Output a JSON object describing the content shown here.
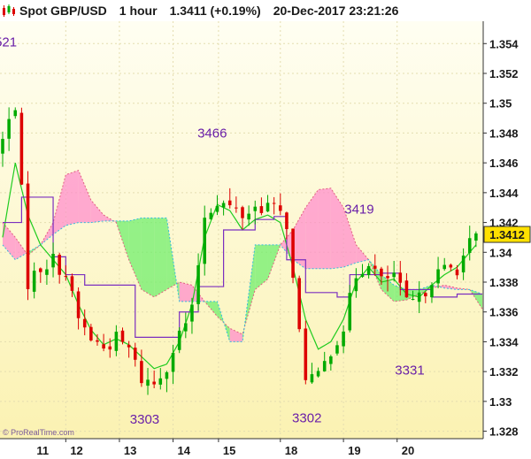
{
  "header": {
    "icon": "candlestick-icon",
    "instrument": "Spot GBP/USD",
    "timeframe": "1 hour",
    "price_change": "1.3411 (+0.19%)",
    "datetime": "20-Dec-2017 23:21:26"
  },
  "watermark": "© ProRealTime.com",
  "colors": {
    "up_candle": "#00aa00",
    "down_candle": "#dd0000",
    "tenkan": "#1fcc1f",
    "kijun": "#7b2fbf",
    "cloud_bull": "#66ee66",
    "cloud_bear": "#ff88cc",
    "label": "#6a1fa8",
    "price_box": "#ffe000"
  },
  "chart_data": {
    "type": "candlestick",
    "indicator": "ichimoku",
    "ylim": [
      1.3275,
      1.3555
    ],
    "y_ticks": [
      "1.328",
      "1.33",
      "1.332",
      "1.334",
      "1.336",
      "1.338",
      "1.34",
      "1.342",
      "1.344",
      "1.346",
      "1.348",
      "1.35",
      "1.352",
      "1.354"
    ],
    "x_ticks": [
      "11",
      "12",
      "13",
      "14",
      "15",
      "18",
      "19",
      "20"
    ],
    "last_price": "1.3412",
    "annotations": [
      {
        "text": "521",
        "x": 0.5,
        "y": 1.3538
      },
      {
        "text": "3466",
        "x": 33.2,
        "y": 1.3477
      },
      {
        "text": "3419",
        "x": 56.5,
        "y": 1.3426
      },
      {
        "text": "3331",
        "x": 64.5,
        "y": 1.3318
      },
      {
        "text": "3303",
        "x": 22.5,
        "y": 1.3285
      },
      {
        "text": "3302",
        "x": 48.2,
        "y": 1.3286
      }
    ],
    "close_anchors": [
      [
        0,
        1.3475
      ],
      [
        2,
        1.35
      ],
      [
        4,
        1.338
      ],
      [
        6,
        1.339
      ],
      [
        8,
        1.3395
      ],
      [
        10,
        1.3385
      ],
      [
        12,
        1.3355
      ],
      [
        14,
        1.3342
      ],
      [
        16,
        1.3336
      ],
      [
        18,
        1.3342
      ],
      [
        20,
        1.3335
      ],
      [
        22,
        1.3315
      ],
      [
        24,
        1.3312
      ],
      [
        26,
        1.3325
      ],
      [
        28,
        1.3345
      ],
      [
        30,
        1.336
      ],
      [
        32,
        1.3425
      ],
      [
        34,
        1.3435
      ],
      [
        36,
        1.343
      ],
      [
        38,
        1.3425
      ],
      [
        40,
        1.343
      ],
      [
        42,
        1.3432
      ],
      [
        44,
        1.3425
      ],
      [
        45,
        1.342
      ],
      [
        46,
        1.338
      ],
      [
        47,
        1.3345
      ],
      [
        48,
        1.3318
      ],
      [
        50,
        1.3315
      ],
      [
        52,
        1.3335
      ],
      [
        54,
        1.335
      ],
      [
        56,
        1.3385
      ],
      [
        58,
        1.3395
      ],
      [
        60,
        1.338
      ],
      [
        62,
        1.3385
      ],
      [
        64,
        1.3365
      ],
      [
        66,
        1.3368
      ],
      [
        68,
        1.3383
      ],
      [
        70,
        1.3388
      ],
      [
        72,
        1.339
      ],
      [
        74,
        1.3405
      ],
      [
        75,
        1.341
      ]
    ],
    "tenkan_anchors": [
      [
        0,
        1.341
      ],
      [
        2,
        1.346
      ],
      [
        4,
        1.3425
      ],
      [
        6,
        1.3405
      ],
      [
        8,
        1.3395
      ],
      [
        10,
        1.3385
      ],
      [
        12,
        1.3365
      ],
      [
        14,
        1.3348
      ],
      [
        16,
        1.3338
      ],
      [
        18,
        1.3342
      ],
      [
        20,
        1.3338
      ],
      [
        22,
        1.333
      ],
      [
        24,
        1.3322
      ],
      [
        26,
        1.3325
      ],
      [
        28,
        1.334
      ],
      [
        30,
        1.3365
      ],
      [
        32,
        1.341
      ],
      [
        34,
        1.3432
      ],
      [
        36,
        1.3428
      ],
      [
        38,
        1.3415
      ],
      [
        40,
        1.3422
      ],
      [
        42,
        1.3425
      ],
      [
        44,
        1.342
      ],
      [
        46,
        1.339
      ],
      [
        48,
        1.3355
      ],
      [
        50,
        1.3335
      ],
      [
        52,
        1.334
      ],
      [
        54,
        1.3355
      ],
      [
        56,
        1.338
      ],
      [
        58,
        1.339
      ],
      [
        60,
        1.338
      ],
      [
        62,
        1.3382
      ],
      [
        64,
        1.3372
      ],
      [
        66,
        1.337
      ],
      [
        68,
        1.3378
      ],
      [
        70,
        1.3385
      ],
      [
        72,
        1.339
      ],
      [
        75,
        1.3405
      ]
    ],
    "kijun_steps": [
      [
        0,
        1.342
      ],
      [
        3,
        1.3437
      ],
      [
        8,
        1.3397
      ],
      [
        10,
        1.3385
      ],
      [
        13,
        1.3378
      ],
      [
        21,
        1.3343
      ],
      [
        28,
        1.336
      ],
      [
        31,
        1.3377
      ],
      [
        35,
        1.3415
      ],
      [
        40,
        1.3422
      ],
      [
        43,
        1.3424
      ],
      [
        45,
        1.3395
      ],
      [
        48,
        1.3373
      ],
      [
        53,
        1.337
      ],
      [
        55,
        1.3385
      ],
      [
        60,
        1.3386
      ],
      [
        63,
        1.3375
      ],
      [
        68,
        1.337
      ],
      [
        72,
        1.3372
      ],
      [
        76,
        1.3372
      ]
    ],
    "span_a": [
      [
        0,
        1.342
      ],
      [
        2,
        1.341
      ],
      [
        4,
        1.3398
      ],
      [
        6,
        1.3405
      ],
      [
        8,
        1.342
      ],
      [
        10,
        1.3452
      ],
      [
        12,
        1.3455
      ],
      [
        14,
        1.3435
      ],
      [
        16,
        1.3425
      ],
      [
        18,
        1.342
      ],
      [
        20,
        1.3395
      ],
      [
        22,
        1.3375
      ],
      [
        24,
        1.337
      ],
      [
        26,
        1.3375
      ],
      [
        28,
        1.338
      ],
      [
        30,
        1.3378
      ],
      [
        32,
        1.3367
      ],
      [
        34,
        1.3357
      ],
      [
        36,
        1.3349
      ],
      [
        38,
        1.3345
      ],
      [
        40,
        1.3375
      ],
      [
        42,
        1.3382
      ],
      [
        44,
        1.3405
      ],
      [
        46,
        1.3415
      ],
      [
        48,
        1.343
      ],
      [
        50,
        1.3442
      ],
      [
        52,
        1.3443
      ],
      [
        54,
        1.343
      ],
      [
        56,
        1.3405
      ],
      [
        58,
        1.3395
      ],
      [
        60,
        1.3375
      ],
      [
        62,
        1.3367
      ],
      [
        64,
        1.3368
      ],
      [
        66,
        1.3372
      ],
      [
        68,
        1.3376
      ],
      [
        70,
        1.3378
      ],
      [
        72,
        1.3376
      ],
      [
        74,
        1.3375
      ],
      [
        76,
        1.3362
      ]
    ],
    "span_b": [
      [
        0,
        1.3405
      ],
      [
        2,
        1.3395
      ],
      [
        4,
        1.34
      ],
      [
        6,
        1.3405
      ],
      [
        8,
        1.3412
      ],
      [
        10,
        1.3418
      ],
      [
        12,
        1.342
      ],
      [
        14,
        1.342
      ],
      [
        16,
        1.3421
      ],
      [
        18,
        1.3421
      ],
      [
        20,
        1.3421
      ],
      [
        22,
        1.3423
      ],
      [
        24,
        1.3423
      ],
      [
        26,
        1.3423
      ],
      [
        28,
        1.3367
      ],
      [
        30,
        1.3367
      ],
      [
        32,
        1.3367
      ],
      [
        34,
        1.3367
      ],
      [
        36,
        1.334
      ],
      [
        38,
        1.334
      ],
      [
        40,
        1.3405
      ],
      [
        42,
        1.3405
      ],
      [
        44,
        1.3405
      ],
      [
        46,
        1.3395
      ],
      [
        48,
        1.3389
      ],
      [
        50,
        1.3389
      ],
      [
        52,
        1.3389
      ],
      [
        54,
        1.339
      ],
      [
        56,
        1.3393
      ],
      [
        58,
        1.3395
      ],
      [
        60,
        1.3385
      ],
      [
        62,
        1.3378
      ],
      [
        64,
        1.3375
      ],
      [
        66,
        1.3375
      ],
      [
        68,
        1.3378
      ],
      [
        70,
        1.3376
      ],
      [
        72,
        1.3375
      ],
      [
        74,
        1.3375
      ],
      [
        76,
        1.3372
      ]
    ]
  }
}
